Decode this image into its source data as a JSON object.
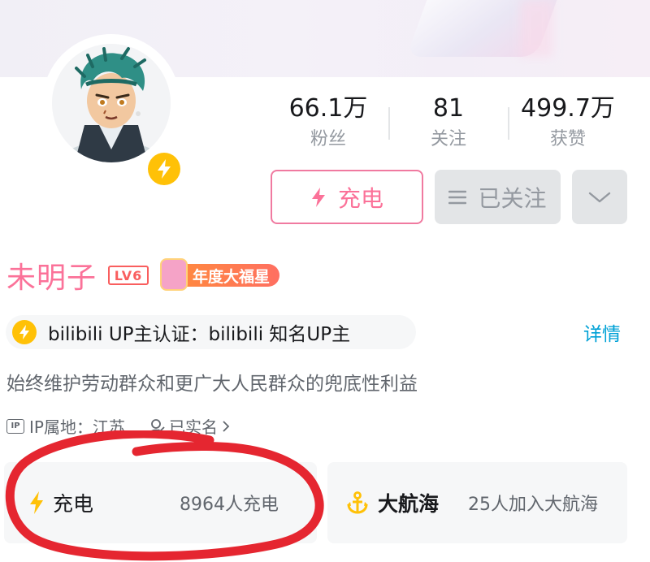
{
  "stats": [
    {
      "value": "66.1万",
      "label": "粉丝"
    },
    {
      "value": "81",
      "label": "关注"
    },
    {
      "value": "499.7万",
      "label": "获赞"
    }
  ],
  "actions": {
    "charge_label": "充电",
    "follow_label": "已关注"
  },
  "user": {
    "name": "未明子",
    "level": "LV6",
    "year_badge": "年度大福星",
    "certification": "bilibili UP主认证：bilibili 知名UP主",
    "detail_link": "详情",
    "signature": "始终维护劳动群众和更广大人民群众的兜底性利益",
    "ip_icon": "IP",
    "ip_location": "IP属地：江苏",
    "realname": "已实名"
  },
  "cards": {
    "charge_title": "充电",
    "charge_count": "8964人充电",
    "fleet_title": "大航海",
    "fleet_count": "25人加入大航海"
  },
  "icons": [
    "avatar",
    "lightning-icon",
    "menu-lines-icon",
    "chevron-down-icon",
    "ip-icon",
    "user-verified-icon",
    "chevron-right-icon",
    "anchor-icon"
  ],
  "colors": {
    "pink": "#fb7299",
    "blue_link": "#00a1d6",
    "gold": "#ffc107",
    "gray_text": "#61666d",
    "red_circle": "#e52630"
  }
}
